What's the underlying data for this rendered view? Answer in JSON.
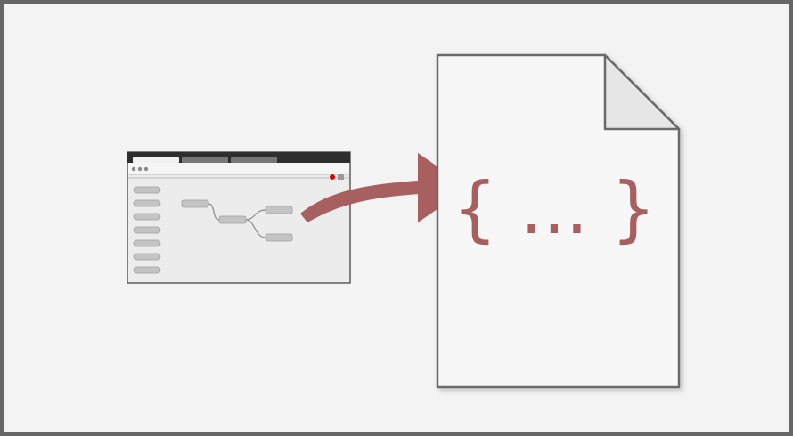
{
  "colors": {
    "frame_border": "#666666",
    "background": "#f3f3f3",
    "arrow": "#a85f60",
    "braces": "#a85f60",
    "file_fill": "#f7f7f7",
    "file_stroke": "#6a6a6a",
    "window_titlebar": "#2e2e2e",
    "window_body": "#ececec",
    "node_fill": "#c4c4c4",
    "status_dot": "#e00000"
  },
  "icons": {
    "editor_window": "editor-window-icon",
    "export_arrow": "curved-arrow-icon",
    "json_file": "file-icon"
  },
  "file": {
    "content_text": "{ ... }"
  },
  "editor": {
    "tab_count": 3,
    "palette_item_count": 7,
    "flow_node_count": 4
  }
}
